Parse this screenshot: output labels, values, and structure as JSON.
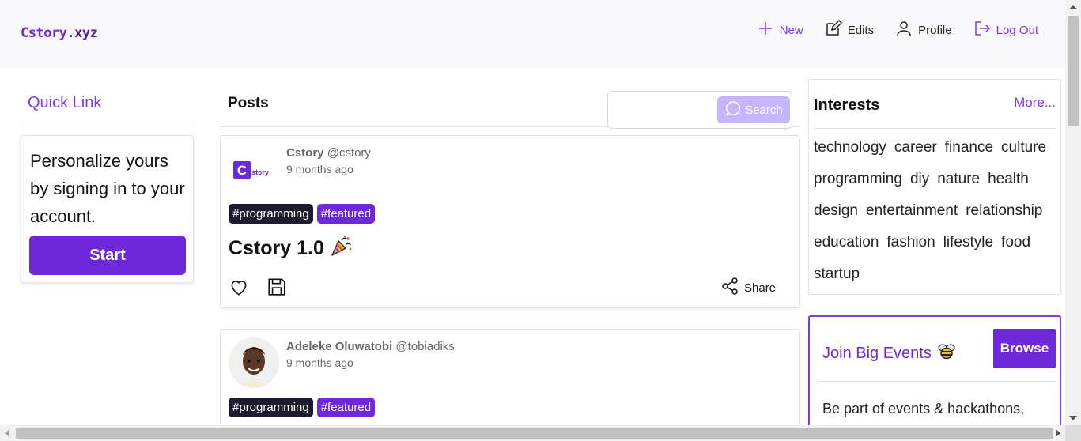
{
  "header": {
    "logo_main": "Cstory",
    "logo_suffix": ".xyz",
    "nav": [
      {
        "label": "New",
        "icon": "plus-icon"
      },
      {
        "label": "Edits",
        "icon": "edit-icon"
      },
      {
        "label": "Profile",
        "icon": "user-icon"
      },
      {
        "label": "Log Out",
        "icon": "logout-icon"
      }
    ]
  },
  "sidebar": {
    "title": "Quick Link",
    "card_text": "Personalize yours by signing in to your account.",
    "start_label": "Start"
  },
  "posts": {
    "title": "Posts",
    "search": {
      "placeholder": "",
      "button_label": "Search"
    },
    "items": [
      {
        "author": "Cstory",
        "handle": "@cstory",
        "time": "9 months ago",
        "tags": [
          "#programming",
          "#featured"
        ],
        "title": "Cstory 1.0",
        "share_label": "Share"
      },
      {
        "author": "Adeleke Oluwatobi",
        "handle": "@tobiadiks",
        "time": "9 months ago",
        "tags": [
          "#programming",
          "#featured"
        ]
      }
    ]
  },
  "interests": {
    "title": "Interests",
    "more_label": "More...",
    "items": [
      "technology",
      "career",
      "finance",
      "culture",
      "programming",
      "diy",
      "nature",
      "health",
      "design",
      "entertainment",
      "relationship",
      "education",
      "fashion",
      "lifestyle",
      "food",
      "startup"
    ]
  },
  "events": {
    "title": "Join Big Events",
    "browse_label": "Browse",
    "text": "Be part of events & hackathons,"
  },
  "colors": {
    "accent": "#7c3aed",
    "brand": "#6d28d9",
    "tag_dark": "#1e1b2e"
  }
}
